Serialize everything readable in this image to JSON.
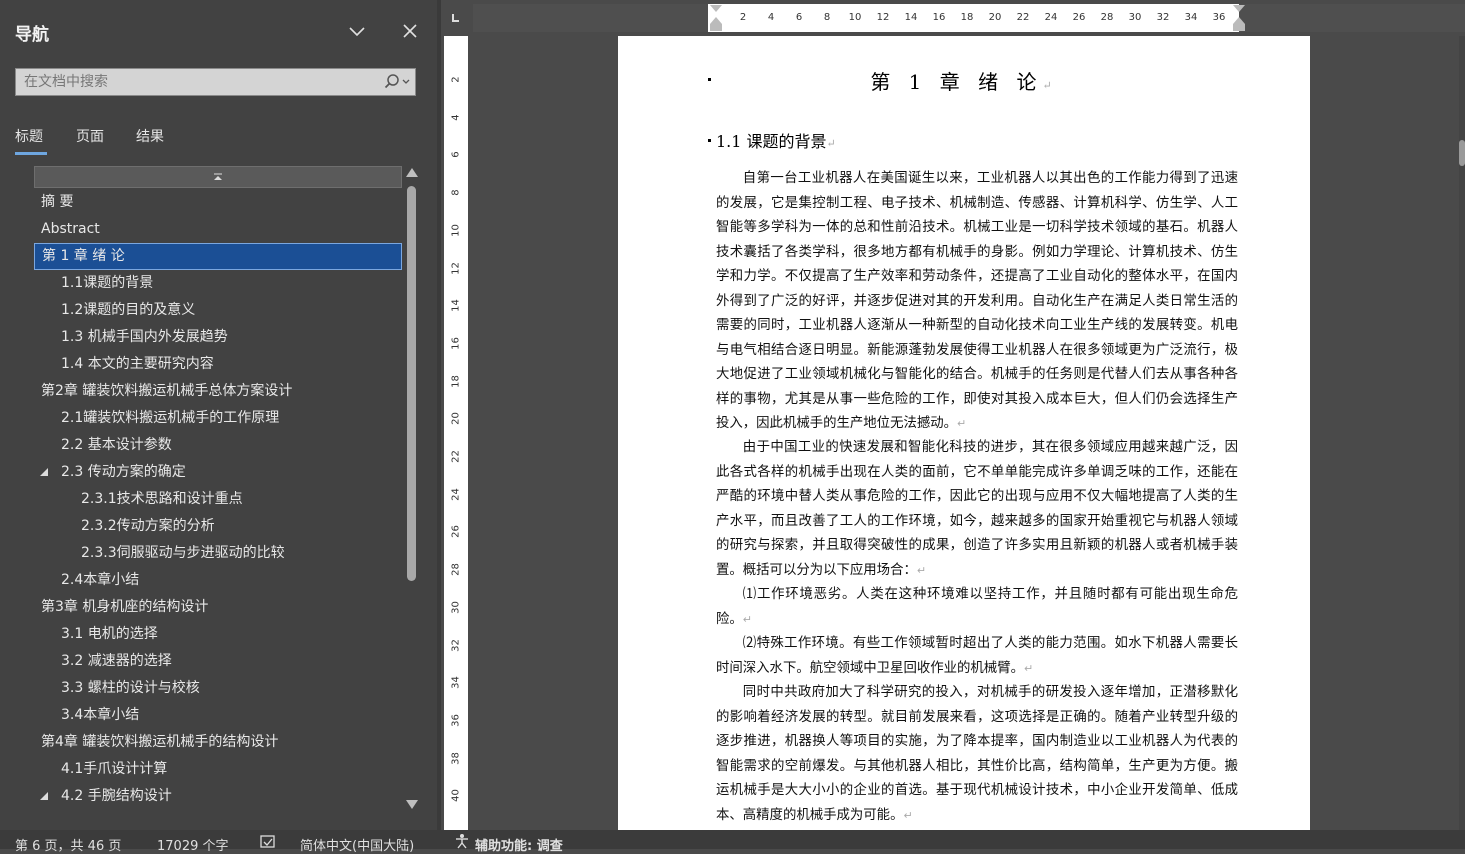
{
  "nav": {
    "title": "导航",
    "search_placeholder": "在文档中搜索",
    "tabs": [
      "标题",
      "页面",
      "结果"
    ],
    "items": [
      {
        "label": "摘  要",
        "level": 0,
        "expanded": null
      },
      {
        "label": "Abstract",
        "level": 0,
        "expanded": null
      },
      {
        "label": "第 1 章 绪  论",
        "level": 0,
        "expanded": true,
        "selected": true
      },
      {
        "label": "1.1课题的背景",
        "level": 1,
        "expanded": null
      },
      {
        "label": "1.2课题的目的及意义",
        "level": 1,
        "expanded": null
      },
      {
        "label": "1.3 机械手国内外发展趋势",
        "level": 1,
        "expanded": null
      },
      {
        "label": "1.4  本文的主要研究内容",
        "level": 1,
        "expanded": null
      },
      {
        "label": "第2章 罐装饮料搬运机械手总体方案设计",
        "level": 0,
        "expanded": true
      },
      {
        "label": "2.1罐装饮料搬运机械手的工作原理",
        "level": 1,
        "expanded": null
      },
      {
        "label": "2.2  基本设计参数",
        "level": 1,
        "expanded": null
      },
      {
        "label": "2.3  传动方案的确定",
        "level": 1,
        "expanded": true
      },
      {
        "label": "2.3.1技术思路和设计重点",
        "level": 2,
        "expanded": null
      },
      {
        "label": "2.3.2传动方案的分析",
        "level": 2,
        "expanded": null
      },
      {
        "label": "2.3.3伺服驱动与步进驱动的比较",
        "level": 2,
        "expanded": null
      },
      {
        "label": "2.4本章小结",
        "level": 1,
        "expanded": null
      },
      {
        "label": "第3章  机身机座的结构设计",
        "level": 0,
        "expanded": true
      },
      {
        "label": "3.1  电机的选择",
        "level": 1,
        "expanded": null
      },
      {
        "label": "3.2 减速器的选择",
        "level": 1,
        "expanded": null
      },
      {
        "label": "3.3  螺柱的设计与校核",
        "level": 1,
        "expanded": null
      },
      {
        "label": "3.4本章小结",
        "level": 1,
        "expanded": null
      },
      {
        "label": "第4章  罐装饮料搬运机械手的结构设计",
        "level": 0,
        "expanded": true
      },
      {
        "label": "4.1手爪设计计算",
        "level": 1,
        "expanded": null
      },
      {
        "label": "4.2  手腕结构设计",
        "level": 1,
        "expanded": true
      }
    ]
  },
  "ruler": {
    "h_ticks": [
      "2",
      "4",
      "6",
      "8",
      "10",
      "12",
      "14",
      "16",
      "18",
      "20",
      "22",
      "24",
      "26",
      "28",
      "30",
      "32",
      "34",
      "36"
    ],
    "v_ticks": [
      "2",
      "4",
      "6",
      "8",
      "10",
      "12",
      "14",
      "16",
      "18",
      "20",
      "22",
      "24",
      "26",
      "28",
      "30",
      "32",
      "34",
      "36",
      "38",
      "40"
    ]
  },
  "document": {
    "title": "第 1 章 绪  论",
    "heading": "1.1 课题的背景",
    "paragraphs": [
      "自第一台工业机器人在美国诞生以来，工业机器人以其出色的工作能力得到了迅速的发展，它是集控制工程、电子技术、机械制造、传感器、计算机科学、仿生学、人工智能等多学科为一体的总和性前沿技术。机械工业是一切科学技术领域的基石。机器人技术囊括了各类学科，很多地方都有机械手的身影。例如力学理论、计算机技术、仿生学和力学。不仅提高了生产效率和劳动条件，还提高了工业自动化的整体水平，在国内外得到了广泛的好评，并逐步促进对其的开发利用。自动化生产在满足人类日常生活的需要的同时，工业机器人逐渐从一种新型的自动化技术向工业生产线的发展转变。机电与电气相结合逐日明显。新能源蓬勃发展使得工业机器人在很多领域更为广泛流行，极大地促进了工业领域机械化与智能化的结合。机械手的任务则是代替人们去从事各种各样的事物，尤其是从事一些危险的工作，即使对其投入成本巨大，但人们仍会选择生产投入，因此机械手的生产地位无法撼动。",
      "由于中国工业的快速发展和智能化科技的进步，其在很多领域应用越来越广泛，因此各式各样的机械手出现在人类的面前，它不单单能完成许多单调乏味的工作，还能在严酷的环境中替人类从事危险的工作，因此它的出现与应用不仅大幅地提高了人类的生产水平，而且改善了工人的工作环境，如今，越来越多的国家开始重视它与机器人领域的研究与探索，并且取得突破性的成果，创造了许多实用且新颖的机器人或者机械手装置。概括可以分为以下应用场合：",
      "⑴工作环境恶劣。人类在这种环境难以坚持工作，并且随时都有可能出现生命危险。",
      "⑵特殊工作环境。有些工作领域暂时超出了人类的能力范围。如水下机器人需要长时间深入水下。航空领域中卫星回收作业的机械臂。",
      "同时中共政府加大了科学研究的投入，对机械手的研发投入逐年增加，正潜移默化的影响着经济发展的转型。就目前发展来看，这项选择是正确的。随着产业转型升级的逐步推进，机器换人等项目的实施，为了降本提率，国内制造业以工业机器人为代表的智能需求的空前爆发。与其他机器人相比，其性价比高，结构简单，生产更为方便。搬运机械手是大大小小的企业的首选。基于现代机械设计技术，中小企业开发简单、低成本、高精度的机械手成为可能。"
    ],
    "paragraph_mark": "↵"
  },
  "status": {
    "page": "第 6 页，共 46 页",
    "words": "17029 个字",
    "language": "简体中文(中国大陆)",
    "accessibility": "辅助功能: 调查"
  },
  "colors": {
    "nav_bg": "#424242",
    "selection": "#1b4f95",
    "accent": "#6ea6e0",
    "page": "#ffffff"
  }
}
